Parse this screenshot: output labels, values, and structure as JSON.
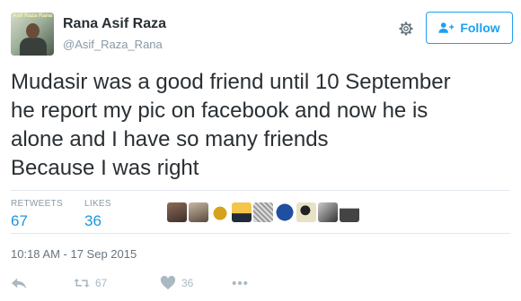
{
  "user": {
    "name": "Rana Asif Raza",
    "handle": "@Asif_Raza_Rana",
    "avatar_caption": "Asif Raza Rana"
  },
  "header": {
    "settings_icon": "gear-icon",
    "follow_label": "Follow",
    "follow_icon": "add-user-icon"
  },
  "tweet": {
    "lines": [
      "Mudasir was a good friend until 10 September",
      "he report my pic on facebook and now he is",
      "alone and I have so many friends",
      "Because I was right"
    ]
  },
  "stats": {
    "retweets_label": "RETWEETS",
    "retweets_count": "67",
    "likes_label": "LIKES",
    "likes_count": "36",
    "liker_count_shown": 9
  },
  "timestamp": "10:18 AM - 17 Sep 2015",
  "actions": {
    "reply_icon": "reply-icon",
    "retweet_icon": "retweet-icon",
    "retweet_count": "67",
    "like_icon": "heart-icon",
    "like_count": "36",
    "more_icon": "more-icon"
  },
  "colors": {
    "accent": "#1da1f2",
    "count_blue": "#1b95e0",
    "text": "#292f33",
    "muted": "#8899a6",
    "icon": "#aab8c2",
    "divider": "#e1e8ed"
  }
}
